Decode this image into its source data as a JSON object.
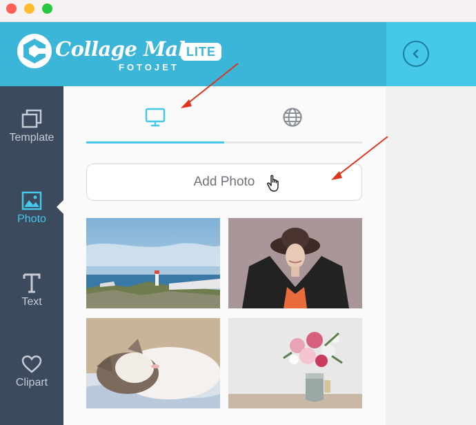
{
  "window": {
    "controls": [
      "close",
      "minimize",
      "zoom"
    ]
  },
  "header": {
    "logo_title": "Collage Maker",
    "badge": "LITE",
    "sub_brand": "FOTOJET",
    "collapse_icon": "chevron-left-circle-icon"
  },
  "sidebar": {
    "items": [
      {
        "label": "Template",
        "icon": "template-icon",
        "active": false
      },
      {
        "label": "Photo",
        "icon": "photo-icon",
        "active": true
      },
      {
        "label": "Text",
        "icon": "text-icon",
        "active": false
      },
      {
        "label": "Clipart",
        "icon": "heart-icon",
        "active": false
      }
    ]
  },
  "panel": {
    "tabs": [
      {
        "icon": "computer-icon",
        "active": true
      },
      {
        "icon": "globe-icon",
        "active": false
      }
    ],
    "add_photo_label": "Add Photo",
    "photos": [
      {
        "subject": "coastal lighthouse landscape"
      },
      {
        "subject": "woman in hat"
      },
      {
        "subject": "sleeping cat"
      },
      {
        "subject": "flowers in vase"
      }
    ]
  },
  "colors": {
    "header": "#3bb5d8",
    "accent": "#45c8e9",
    "sidebar": "#3c4a5d",
    "annotation_arrow": "#e0341c"
  }
}
